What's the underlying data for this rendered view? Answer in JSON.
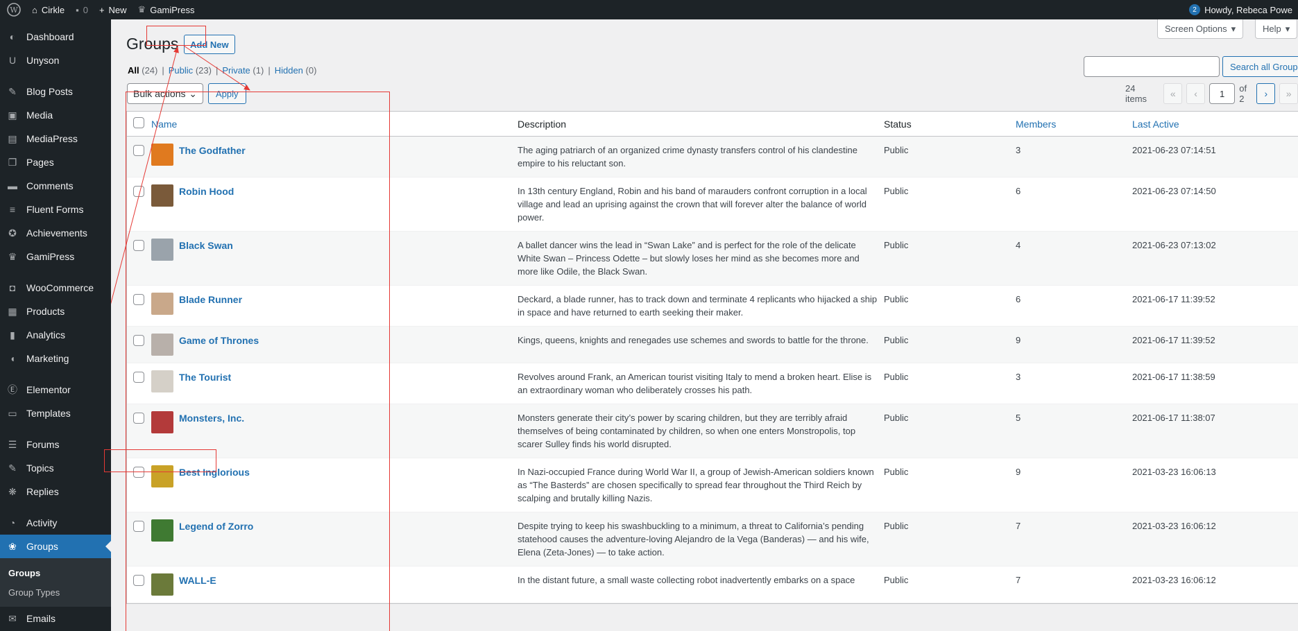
{
  "adminbar": {
    "site_name": "Cirkle",
    "comments_count": "0",
    "new_label": "New",
    "gamipress_label": "GamiPress",
    "notification_count": "2",
    "howdy": "Howdy, Rebeca Powe"
  },
  "sidebar": {
    "items": [
      {
        "label": "Dashboard",
        "icon": "dashboard-icon"
      },
      {
        "label": "Unyson",
        "icon": "unyson-icon"
      },
      {
        "label": "Blog Posts",
        "icon": "pin-icon"
      },
      {
        "label": "Media",
        "icon": "media-icon"
      },
      {
        "label": "MediaPress",
        "icon": "mediapress-icon"
      },
      {
        "label": "Pages",
        "icon": "pages-icon"
      },
      {
        "label": "Comments",
        "icon": "comments-icon"
      },
      {
        "label": "Fluent Forms",
        "icon": "forms-icon"
      },
      {
        "label": "Achievements",
        "icon": "achievements-icon"
      },
      {
        "label": "GamiPress",
        "icon": "crown-icon"
      },
      {
        "label": "WooCommerce",
        "icon": "woo-icon"
      },
      {
        "label": "Products",
        "icon": "products-icon"
      },
      {
        "label": "Analytics",
        "icon": "analytics-icon"
      },
      {
        "label": "Marketing",
        "icon": "megaphone-icon"
      },
      {
        "label": "Elementor",
        "icon": "elementor-icon"
      },
      {
        "label": "Templates",
        "icon": "folder-icon"
      },
      {
        "label": "Forums",
        "icon": "forums-icon"
      },
      {
        "label": "Topics",
        "icon": "topics-icon"
      },
      {
        "label": "Replies",
        "icon": "replies-icon"
      },
      {
        "label": "Activity",
        "icon": "activity-icon"
      },
      {
        "label": "Groups",
        "icon": "groups-icon"
      },
      {
        "label": "Emails",
        "icon": "email-icon"
      }
    ],
    "submenu": [
      "Groups",
      "Group Types"
    ]
  },
  "header": {
    "title": "Groups",
    "add_new": "Add New",
    "screen_options": "Screen Options",
    "help": "Help"
  },
  "filters": {
    "all": "All",
    "all_count": "(24)",
    "public": "Public",
    "public_count": "(23)",
    "private": "Private",
    "private_count": "(1)",
    "hidden": "Hidden",
    "hidden_count": "(0)"
  },
  "search": {
    "button": "Search all Groups"
  },
  "bulk": {
    "select": "Bulk actions",
    "apply": "Apply"
  },
  "pagination": {
    "items": "24 items",
    "first": "«",
    "prev": "‹",
    "current": "1",
    "of": "of 2",
    "next": "›",
    "last": "»"
  },
  "table": {
    "headers": {
      "name": "Name",
      "description": "Description",
      "status": "Status",
      "members": "Members",
      "last_active": "Last Active"
    },
    "rows": [
      {
        "name": "The Godfather",
        "description": "The aging patriarch of an organized crime dynasty transfers control of his clandestine empire to his reluctant son.",
        "status": "Public",
        "members": "3",
        "last_active": "2021-06-23 07:14:51",
        "avatar_color": "#e07a1f"
      },
      {
        "name": "Robin Hood",
        "description": "In 13th century England, Robin and his band of marauders confront corruption in a local village and lead an uprising against the crown that will forever alter the balance of world power.",
        "status": "Public",
        "members": "6",
        "last_active": "2021-06-23 07:14:50",
        "avatar_color": "#7a5a3a"
      },
      {
        "name": "Black Swan",
        "description": "A ballet dancer wins the lead in “Swan Lake” and is perfect for the role of the delicate White Swan – Princess Odette – but slowly loses her mind as she becomes more and more like Odile, the Black Swan.",
        "status": "Public",
        "members": "4",
        "last_active": "2021-06-23 07:13:02",
        "avatar_color": "#9aa3ab"
      },
      {
        "name": "Blade Runner",
        "description": "Deckard, a blade runner, has to track down and terminate 4 replicants who hijacked a ship in space and have returned to earth seeking their maker.",
        "status": "Public",
        "members": "6",
        "last_active": "2021-06-17 11:39:52",
        "avatar_color": "#c9a88a"
      },
      {
        "name": "Game of Thrones",
        "description": "Kings, queens, knights and renegades use schemes and swords to battle for the throne.",
        "status": "Public",
        "members": "9",
        "last_active": "2021-06-17 11:39:52",
        "avatar_color": "#b8b0aa"
      },
      {
        "name": "The Tourist",
        "description": "Revolves around Frank, an American tourist visiting Italy to mend a broken heart. Elise is an extraordinary woman who deliberately crosses his path.",
        "status": "Public",
        "members": "3",
        "last_active": "2021-06-17 11:38:59",
        "avatar_color": "#d5d0c8"
      },
      {
        "name": "Monsters, Inc.",
        "description": "Monsters generate their city’s power by scaring children, but they are terribly afraid themselves of being contaminated by children, so when one enters Monstropolis, top scarer Sulley finds his world disrupted.",
        "status": "Public",
        "members": "5",
        "last_active": "2021-06-17 11:38:07",
        "avatar_color": "#b33a3a"
      },
      {
        "name": "Best Inglorious",
        "description": "In Nazi-occupied France during World War II, a group of Jewish-American soldiers known as “The Basterds” are chosen specifically to spread fear throughout the Third Reich by scalping and brutally killing Nazis.",
        "status": "Public",
        "members": "9",
        "last_active": "2021-03-23 16:06:13",
        "avatar_color": "#c9a227"
      },
      {
        "name": "Legend of Zorro",
        "description": "Despite trying to keep his swashbuckling to a minimum, a threat to California’s pending statehood causes the adventure-loving Alejandro de la Vega (Banderas) — and his wife, Elena (Zeta-Jones) — to take action.",
        "status": "Public",
        "members": "7",
        "last_active": "2021-03-23 16:06:12",
        "avatar_color": "#3f7a32"
      },
      {
        "name": "WALL-E",
        "description": "In the distant future, a small waste collecting robot inadvertently embarks on a space",
        "status": "Public",
        "members": "7",
        "last_active": "2021-03-23 16:06:12",
        "avatar_color": "#6b7a3a"
      }
    ]
  }
}
